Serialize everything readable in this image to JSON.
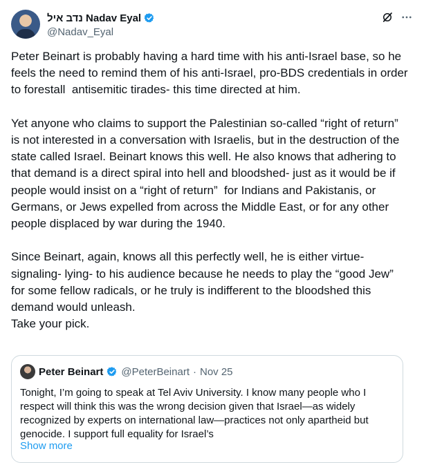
{
  "author": {
    "display_name": "נדב איל Nadav Eyal",
    "handle": "@Nadav_Eyal"
  },
  "icons": [
    "grok-icon",
    "more-icon",
    "verified-badge-icon"
  ],
  "body": {
    "p1": "Peter Beinart is probably having a hard time with his anti-Israel base, so he feels the need to remind them of his anti-Israel, pro-BDS credentials in order to forestall  antisemitic tirades- this time directed at him.",
    "p2": "Yet anyone who claims to support the Palestinian so-called “right of return” is not interested in a conversation with Israelis, but in the destruction of the state called Israel. Beinart knows this well. He also knows that adhering to that demand is a direct spiral into hell and bloodshed- just as it would be if  people would insist on a “right of return”  for Indians and Pakistanis, or Germans, or Jews expelled from across the Middle East, or for any other people displaced by war during the 1940.",
    "p3": "Since Beinart, again, knows all this perfectly well, he is either virtue-signaling- lying- to his audience because he needs to play the “good Jew” for some fellow radicals, or he truly is indifferent to the bloodshed this demand would unleash.",
    "p4": "Take your pick."
  },
  "quote": {
    "display_name": "Peter Beinart",
    "handle": "@PeterBeinart",
    "separator": "·",
    "date": "Nov 25",
    "text": "Tonight, I’m going to speak at Tel Aviv University. I know many people who I respect will think this was the wrong decision given that Israel—as widely recognized by experts on international law—practices not only apartheid but genocide. I support full equality for Israel’s",
    "show_more": "Show more"
  },
  "colors": {
    "text": "#0f1419",
    "muted": "#536471",
    "link": "#1d9bf0",
    "verified": "#1d9bf0",
    "border": "#cfd9de"
  }
}
